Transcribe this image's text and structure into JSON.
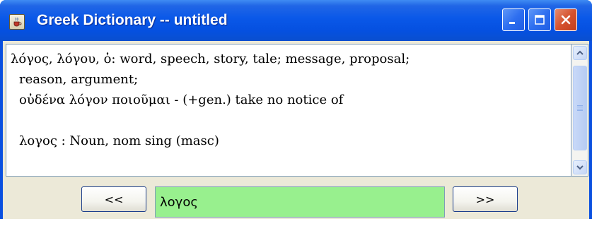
{
  "window": {
    "title": "Greek Dictionary -- untitled",
    "icon": "java-cup-icon",
    "controls": {
      "minimize": "minimize-icon",
      "maximize": "maximize-icon",
      "close": "close-icon"
    }
  },
  "entry": {
    "lines": [
      "λόγος, λόγου, ὁ:  word, speech, story, tale; message, proposal;",
      "reason, argument;",
      "οὐδένα λόγον ποιοῦμαι - (+gen.) take no notice of",
      "",
      "λογος : Noun, nom sing (masc)"
    ]
  },
  "navigation": {
    "prev_label": "<<",
    "next_label": ">>",
    "search_value": "λογος"
  },
  "colors": {
    "titlebar": "#0a58e8",
    "input_background": "#98f08e",
    "client_background": "#ece9d8"
  }
}
